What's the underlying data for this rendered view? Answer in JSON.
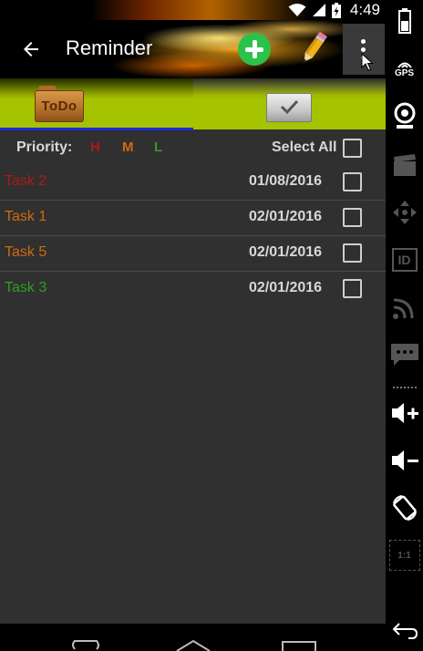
{
  "status_bar": {
    "time": "4:49"
  },
  "action_bar": {
    "title": "Reminder"
  },
  "tabs": {
    "todo_label": "ToDo"
  },
  "filter": {
    "priority_label": "Priority:",
    "priority_high": "H",
    "priority_medium": "M",
    "priority_low": "L",
    "select_all_label": "Select All"
  },
  "tasks": [
    {
      "name": "Task 2",
      "date": "01/08/2016",
      "priority": "high",
      "color": "#b01818"
    },
    {
      "name": "Task 1",
      "date": "02/01/2016",
      "priority": "medium",
      "color": "#d06a10"
    },
    {
      "name": "Task 5",
      "date": "02/01/2016",
      "priority": "medium",
      "color": "#d06a10"
    },
    {
      "name": "Task 3",
      "date": "02/01/2016",
      "priority": "low",
      "color": "#2f9e20"
    }
  ],
  "side_panel": {
    "gps_label": "GPS",
    "id_label": "ID",
    "scale_label": "1:1"
  },
  "colors": {
    "accent_tab_indicator": "#1e2bd8",
    "tab_green": "#a6c300",
    "add_button": "#2bc24a",
    "background": "#303030"
  }
}
